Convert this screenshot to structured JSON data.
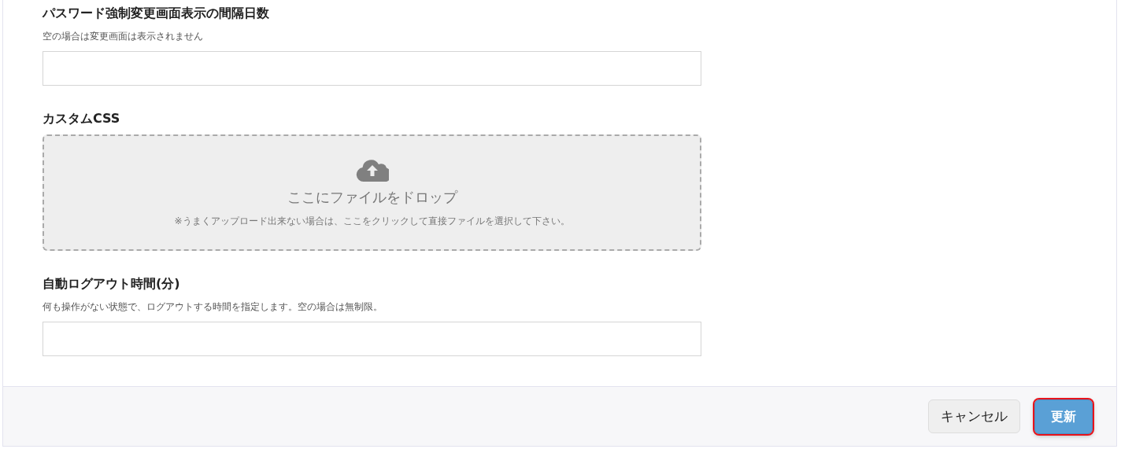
{
  "fields": [
    {
      "kind": "text",
      "label": "パスワード強制変更画面表示の間隔日数",
      "help": "空の場合は変更画面は表示されません"
    },
    {
      "kind": "dropzone",
      "label": "カスタムCSS",
      "drop_text": "ここにファイルをドロップ",
      "drop_note": "※うまくアップロード出来ない場合は、ここをクリックして直接ファイルを選択して下さい。"
    },
    {
      "kind": "text",
      "label": "自動ログアウト時間(分)",
      "help": "何も操作がない状態で、ログアウトする時間を指定します。空の場合は無制限。"
    }
  ],
  "footer": {
    "buttons": [
      {
        "kind": "secondary",
        "label": "キャンセル",
        "focused": false
      },
      {
        "kind": "primary",
        "label": "更新",
        "focused": true
      }
    ]
  }
}
